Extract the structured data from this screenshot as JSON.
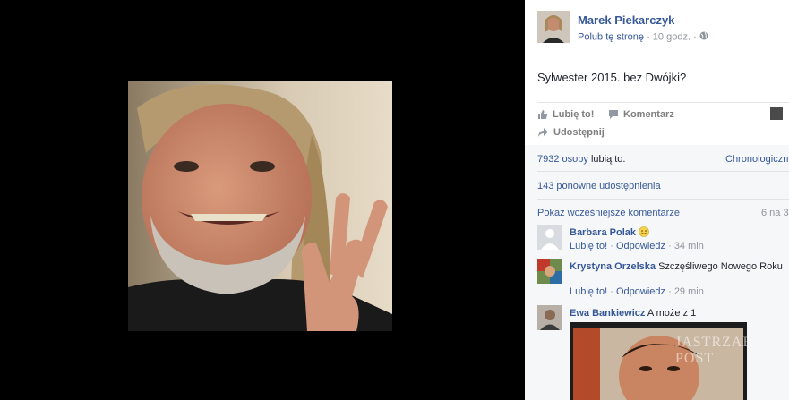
{
  "post": {
    "author": "Marek Piekarczyk",
    "like_page": "Polub tę stronę",
    "separator": "·",
    "time": "10 godz.",
    "text": "Sylwester 2015. bez Dwójki?"
  },
  "actions": {
    "like": "Lubię to!",
    "comment": "Komentarz",
    "share": "Udostępnij"
  },
  "stats": {
    "likes_count": "7932 osoby",
    "likes_suffix": "lubią to.",
    "sort": "Chronologiczni",
    "shares": "143 ponowne udostępnienia"
  },
  "comments_section": {
    "show_earlier": "Pokaż wcześniejsze komentarze",
    "count": "6 na 3",
    "items": [
      {
        "name": "Barbara Polak",
        "text": "",
        "like": "Lubię to!",
        "reply": "Odpowiedz",
        "time": "34 min"
      },
      {
        "name": "Krystyna Orzelska",
        "text": "Szczęśliwego Nowego Roku",
        "like": "Lubię to!",
        "reply": "Odpowiedz",
        "time": "29 min"
      },
      {
        "name": "Ewa Bankiewicz",
        "text": "A może z 1",
        "like": "",
        "reply": "",
        "time": ""
      }
    ]
  },
  "watermark": "JASTRZAB POST",
  "icons": {
    "globe": "globe-icon",
    "thumb": "thumbs-up-icon",
    "comment": "comment-icon",
    "share": "share-icon",
    "smile": "smile-emoji-icon"
  },
  "colors": {
    "link": "#365899",
    "muted": "#90949c",
    "background_viewer": "#000000"
  }
}
